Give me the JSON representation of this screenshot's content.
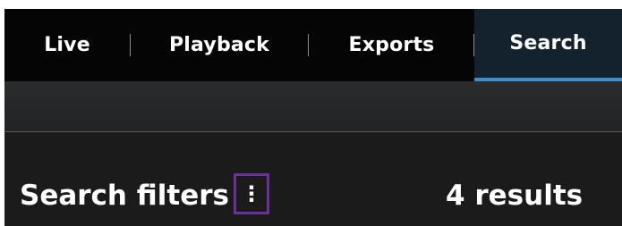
{
  "tabs": {
    "live": "Live",
    "playback": "Playback",
    "exports": "Exports",
    "search": "Search",
    "active": "Search"
  },
  "filters": {
    "title": "Search filters",
    "more_icon": "⋮",
    "results": "4 results"
  },
  "colors": {
    "accent": "#3e8fd0",
    "highlight": "#6c2f9b",
    "tab_background": "#050505",
    "panel_background": "#1b1b1b"
  },
  "icons": {
    "more": "vertical-ellipsis-icon"
  }
}
